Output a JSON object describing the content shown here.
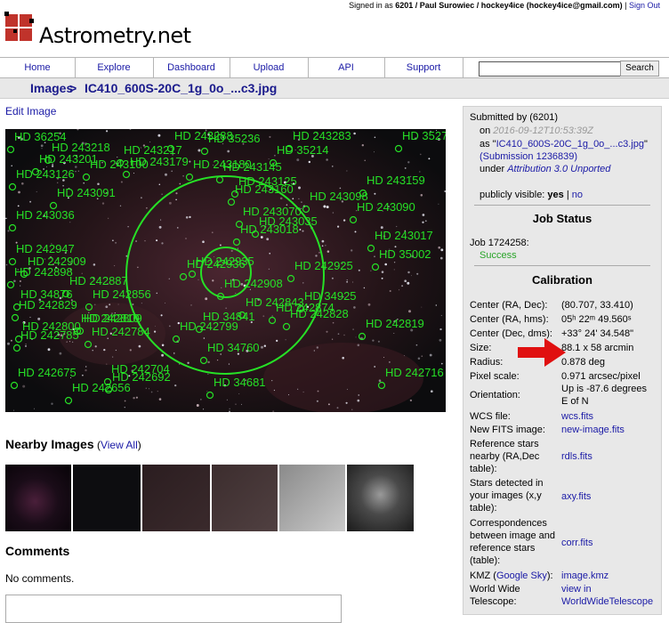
{
  "header": {
    "signed_in_prefix": "Signed in as ",
    "user": "6201 / Paul Surowiec / hockey4ice (hockey4ice@gmail.com)",
    "separator": " | ",
    "sign_out": "Sign Out",
    "logo_text": "Astrometry.net"
  },
  "nav": {
    "items": [
      "Home",
      "Explore",
      "Dashboard",
      "Upload",
      "API",
      "Support"
    ],
    "search_button": "Search",
    "search_value": ""
  },
  "breadcrumb": {
    "images": "Images",
    "sep": " > ",
    "file": "IC410_600S-20C_1g_0o_...c3.jpg"
  },
  "edit_image": "Edit Image",
  "sky": {
    "labels": [
      "HD 36254",
      "HD 243288",
      "HD 243283",
      "HD 35279",
      "HD 243218",
      "HD 243217",
      "HD 35236",
      "HD 35214",
      "HD 243201",
      "HD 243179",
      "HD 243100",
      "HD 243180",
      "HD 243145",
      "HD 243126",
      "HD 243125",
      "HD 243159",
      "HD 243091",
      "HD 243160",
      "HD 243098",
      "HD 243036",
      "HD 243090",
      "HD 243070",
      "HD 243035",
      "HD 243017",
      "HD 243018",
      "HD 242947",
      "HD 35002",
      "HD 242909",
      "HD 242936",
      "HD 242935",
      "HD 242898",
      "HD 242925",
      "HD 242887",
      "HD 242908",
      "HD 34876",
      "HD 242856",
      "HD 34925",
      "HD 242829",
      "HD 242843",
      "HD 242874",
      "HD 242810",
      "HD 242809",
      "HD 242828",
      "HD 242800",
      "HD 34841",
      "HD 242819",
      "HD 242785",
      "HD 242784",
      "HD 242799",
      "HD 34760",
      "HD 242704",
      "HD 242675",
      "HD 242692",
      "HD 242716",
      "HD 242656",
      "HD 34681"
    ]
  },
  "nearby": {
    "title": "Nearby Images",
    "view_all": "View All",
    "open": " (",
    "close": ")"
  },
  "comments": {
    "title": "Comments",
    "empty": "No comments."
  },
  "sidebar": {
    "submitted_by": "Submitted by ",
    "submitter": "(6201)",
    "on": "on ",
    "date": "2016-09-12T10:53:39Z",
    "as": "as \"",
    "as_file": "IC410_600S-20C_1g_0o_...c3.jpg",
    "as_end": "\"",
    "submission": "(Submission 1236839)",
    "under": "under ",
    "license": "Attribution 3.0 Unported",
    "visible_label": "publicly visible: ",
    "visible_yes": "yes",
    "visible_sep": " | ",
    "visible_no": "no",
    "job_status_title": "Job Status",
    "job": "Job 1724258:",
    "job_status": "Success",
    "calibration_title": "Calibration",
    "rows": [
      {
        "k": "Center (RA, Dec):",
        "v": "(80.707, 33.410)"
      },
      {
        "k": "Center (RA, hms):",
        "v": "05ʰ 22ᵐ 49.560ˢ"
      },
      {
        "k": "Center (Dec, dms):",
        "v": "+33° 24' 34.548\""
      },
      {
        "k": "Size:",
        "v": "88.1 x 58 arcmin"
      },
      {
        "k": "Radius:",
        "v": "0.878 deg"
      },
      {
        "k": "Pixel scale:",
        "v": "0.971 arcsec/pixel"
      },
      {
        "k": "Orientation:",
        "v": "Up is -87.6 degrees E of N"
      },
      {
        "k": "WCS file:",
        "v": "wcs.fits"
      },
      {
        "k": "New FITS image:",
        "v": "new-image.fits"
      },
      {
        "k": "Reference stars nearby (RA,Dec table):",
        "v": "rdls.fits"
      },
      {
        "k": "Stars detected in your images (x,y table):",
        "v": "axy.fits"
      },
      {
        "k": "Correspondences between image and reference stars (table):",
        "v": "corr.fits"
      },
      {
        "k": "KMZ (Google Sky):",
        "v": "image.kmz"
      },
      {
        "k": "World Wide Telescope:",
        "v": "view in WorldWideTelescope"
      }
    ],
    "kmz_prefix": "KMZ (",
    "kmz_link": "Google Sky",
    "kmz_suffix": "):"
  },
  "colors": {
    "link": "#1a1aa6",
    "overlay": "#26e026",
    "success": "#28a428",
    "arrow": "#e01010"
  }
}
